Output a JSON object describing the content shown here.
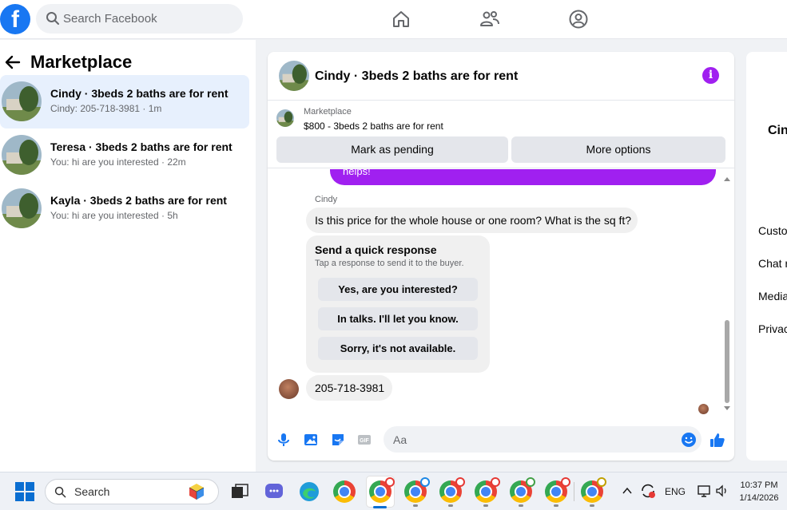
{
  "header": {
    "logo": "f",
    "search_placeholder": "Search Facebook",
    "nav_icons": [
      "home-icon",
      "friends-icon",
      "profile-circle-icon"
    ]
  },
  "sidebar": {
    "title": "Marketplace",
    "conversations": [
      {
        "title": "Cindy · 3beds 2 baths are for rent",
        "preview": "Cindy: 205-718-3981 · 1m",
        "active": true
      },
      {
        "title": "Teresa · 3beds 2 baths are for rent",
        "preview": "You: hi are you interested · 22m",
        "active": false
      },
      {
        "title": "Kayla · 3beds 2 baths are for rent",
        "preview": "You: hi are you interested · 5h",
        "active": false
      }
    ]
  },
  "chat": {
    "title": "Cindy · 3beds 2 baths are for rent",
    "listing": {
      "label": "Marketplace",
      "detail": "$800 - 3beds 2 baths are for rent"
    },
    "actions": {
      "mark_pending": "Mark as pending",
      "more_options": "More options"
    },
    "purple_bubble_text": "helps!",
    "sender": "Cindy",
    "incoming_message": "Is this price for the whole house or one room? What is the sq ft?",
    "quick_response": {
      "title": "Send a quick response",
      "subtitle": "Tap a response to send it to the buyer.",
      "options": [
        "Yes, are you interested?",
        "In talks. I'll let you know.",
        "Sorry, it's not available."
      ]
    },
    "phone_message": "205-718-3981",
    "composer_placeholder": "Aa"
  },
  "right_panel": {
    "name": "Cin",
    "items": [
      "Custo",
      "Chat r",
      "Media",
      "Privac"
    ]
  },
  "taskbar": {
    "search_label": "Search",
    "language": "ENG",
    "time": "10:37 PM",
    "date": "1/14/2026"
  },
  "colors": {
    "facebook_blue": "#1877f2",
    "accent_purple": "#a020f0",
    "active_conversation_bg": "#e7f0fd"
  }
}
